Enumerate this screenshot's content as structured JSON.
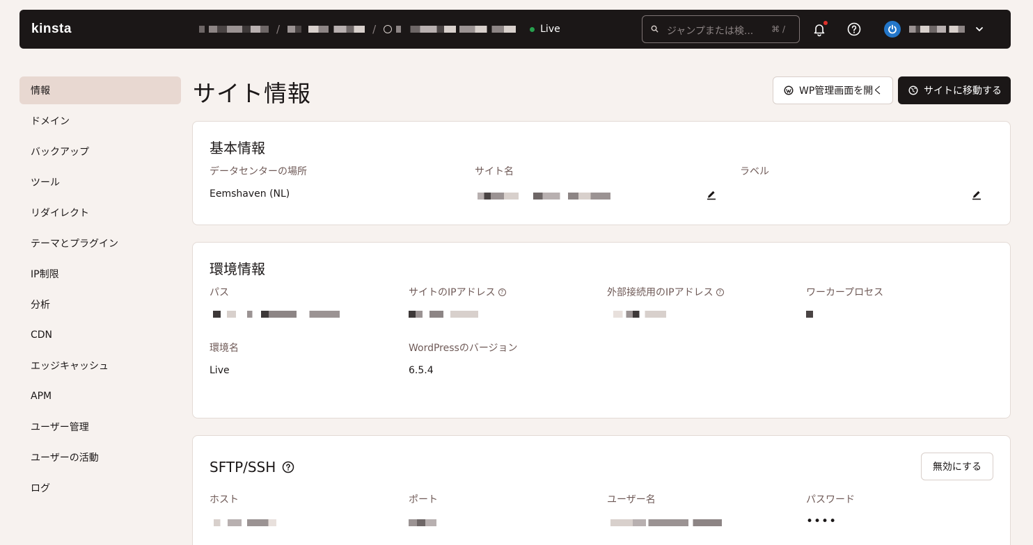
{
  "brand": {
    "logo": "kinsta"
  },
  "header": {
    "environment_status": "Live",
    "search_placeholder": "ジャンプまたは検...",
    "search_shortcut": "⌘ /",
    "status_color": "#27a04e"
  },
  "sidebar": {
    "items": [
      {
        "label": "情報",
        "active": true
      },
      {
        "label": "ドメイン"
      },
      {
        "label": "バックアップ"
      },
      {
        "label": "ツール"
      },
      {
        "label": "リダイレクト"
      },
      {
        "label": "テーマとプラグイン"
      },
      {
        "label": "IP制限"
      },
      {
        "label": "分析"
      },
      {
        "label": "CDN"
      },
      {
        "label": "エッジキャッシュ"
      },
      {
        "label": "APM"
      },
      {
        "label": "ユーザー管理"
      },
      {
        "label": "ユーザーの活動"
      },
      {
        "label": "ログ"
      }
    ]
  },
  "page": {
    "title": "サイト情報",
    "open_wp_admin": "WP管理画面を開く",
    "visit_site": "サイトに移動する"
  },
  "basic_info": {
    "title": "基本情報",
    "datacenter_label": "データセンターの場所",
    "datacenter_value": "Eemshaven (NL)",
    "site_name_label": "サイト名",
    "label_label": "ラベル"
  },
  "environment": {
    "title": "環境情報",
    "path_label": "パス",
    "site_ip_label": "サイトのIPアドレス",
    "external_ip_label": "外部接続用のIPアドレス",
    "workers_label": "ワーカープロセス",
    "env_name_label": "環境名",
    "env_name_value": "Live",
    "wp_version_label": "WordPressのバージョン",
    "wp_version_value": "6.5.4"
  },
  "sftp": {
    "title": "SFTP/SSH",
    "disable_button": "無効にする",
    "host_label": "ホスト",
    "port_label": "ポート",
    "username_label": "ユーザー名",
    "password_label": "パスワード",
    "password_value": "••••"
  }
}
